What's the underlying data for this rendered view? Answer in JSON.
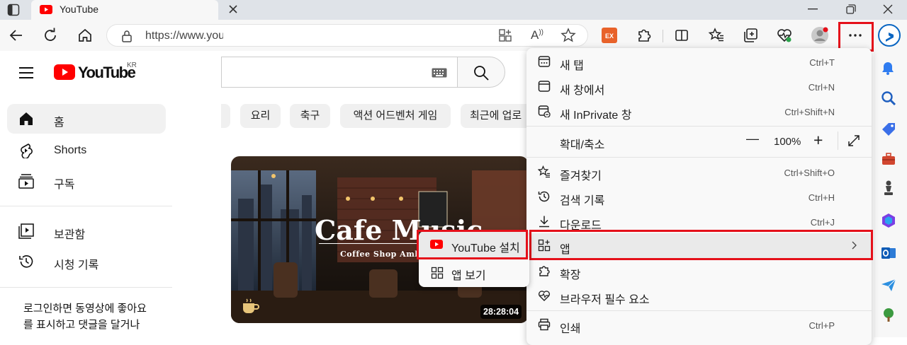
{
  "browser": {
    "tab_title": "YouTube",
    "url": "https://www.youtube.com",
    "zoom_value": "100%"
  },
  "youtube": {
    "logo_text": "YouTube",
    "region": "KR",
    "nav": [
      {
        "label": "홈",
        "icon": "home-icon"
      },
      {
        "label": "Shorts",
        "icon": "shorts-icon"
      },
      {
        "label": "구독",
        "icon": "subscriptions-icon"
      },
      {
        "label": "보관함",
        "icon": "library-icon"
      },
      {
        "label": "시청 기록",
        "icon": "history-icon"
      }
    ],
    "signin_prompt_line1": "로그인하면 동영상에 좋아요",
    "signin_prompt_line2": "를 표시하고 댓글을 달거나",
    "chips": [
      "요리",
      "축구",
      "액션 어드벤처 게임",
      "최근에 업로"
    ],
    "video": {
      "thumb_title": "Cafe Music",
      "thumb_subtitle": "Coffee Shop Ambience",
      "duration": "28:28:04"
    }
  },
  "menu": {
    "items": [
      {
        "label": "새 탭",
        "shortcut": "Ctrl+T",
        "icon": "new-tab-icon"
      },
      {
        "label": "새 창에서",
        "shortcut": "Ctrl+N",
        "icon": "new-window-icon"
      },
      {
        "label": "새 InPrivate 창",
        "shortcut": "Ctrl+Shift+N",
        "icon": "inprivate-icon"
      },
      {
        "label": "확대/축소",
        "shortcut": "",
        "icon": ""
      },
      {
        "label": "즐겨찾기",
        "shortcut": "Ctrl+Shift+O",
        "icon": "favorites-icon"
      },
      {
        "label": "검색 기록",
        "shortcut": "Ctrl+H",
        "icon": "history-icon"
      },
      {
        "label": "다운로드",
        "shortcut": "Ctrl+J",
        "icon": "download-icon"
      },
      {
        "label": "앱",
        "shortcut": "",
        "icon": "apps-icon"
      },
      {
        "label": "확장",
        "shortcut": "",
        "icon": "extensions-icon"
      },
      {
        "label": "브라우저 필수 요소",
        "shortcut": "",
        "icon": "heart-pulse-icon"
      },
      {
        "label": "인쇄",
        "shortcut": "Ctrl+P",
        "icon": "print-icon"
      }
    ],
    "zoom_minus": "—",
    "zoom_plus": "+"
  },
  "submenu": {
    "install": "YouTube 설치",
    "view": "앱 보기"
  },
  "colors": {
    "youtube_red": "#ff0000",
    "highlight_red": "#e5101a",
    "accent_blue": "#0a66c2"
  }
}
